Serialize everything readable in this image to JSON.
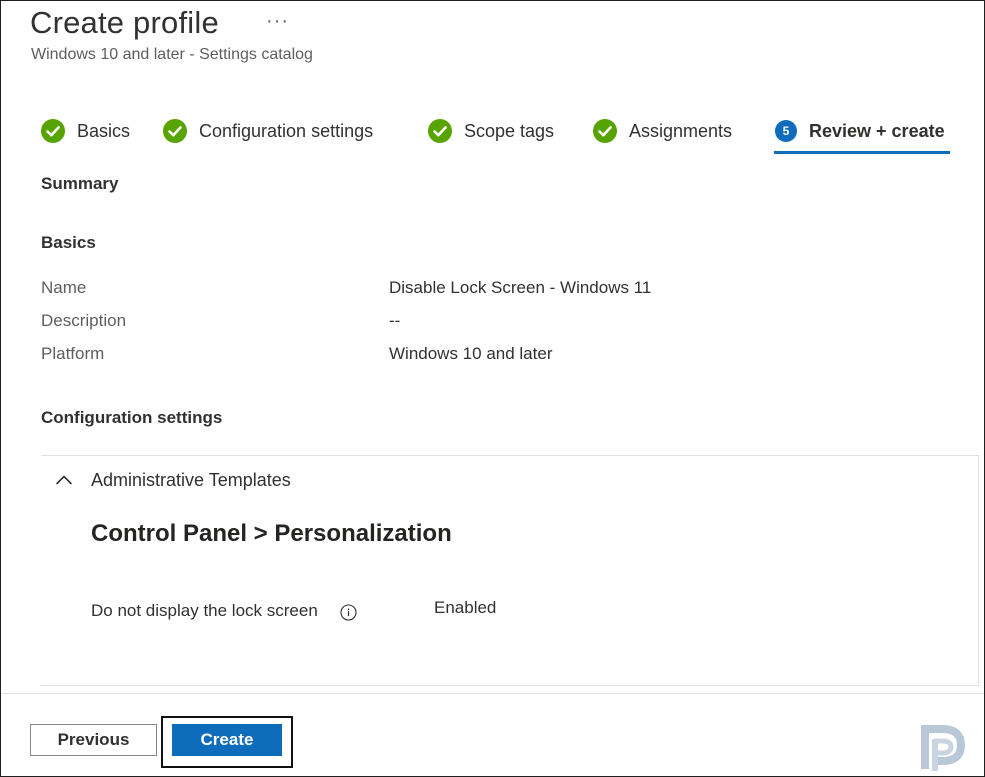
{
  "header": {
    "title": "Create profile",
    "more_glyph": "···",
    "subtitle": "Windows 10 and later - Settings catalog"
  },
  "wizard": {
    "steps": [
      {
        "label": "Basics",
        "status": "complete"
      },
      {
        "label": "Configuration settings",
        "status": "complete"
      },
      {
        "label": "Scope tags",
        "status": "complete"
      },
      {
        "label": "Assignments",
        "status": "complete"
      },
      {
        "label": "Review + create",
        "status": "active",
        "number": "5"
      }
    ]
  },
  "summary": {
    "heading": "Summary",
    "basics_heading": "Basics",
    "rows": [
      {
        "label": "Name",
        "value": "Disable Lock Screen - Windows 11"
      },
      {
        "label": "Description",
        "value": "--"
      },
      {
        "label": "Platform",
        "value": "Windows 10 and later"
      }
    ],
    "config_heading": "Configuration settings",
    "accordion": {
      "title": "Administrative Templates",
      "category": "Control Panel > Personalization",
      "setting": {
        "label": "Do not display the lock screen",
        "value": "Enabled"
      }
    }
  },
  "footer": {
    "previous_label": "Previous",
    "create_label": "Create"
  },
  "colors": {
    "accent": "#0f6cbd",
    "success": "#57a300",
    "text": "#323130",
    "muted": "#605e5c"
  },
  "icons": {
    "complete": "check-circle-icon",
    "info": "info-icon",
    "chevron": "chevron-up-icon",
    "more": "more-icon",
    "logo": "brand-logo-icon"
  }
}
